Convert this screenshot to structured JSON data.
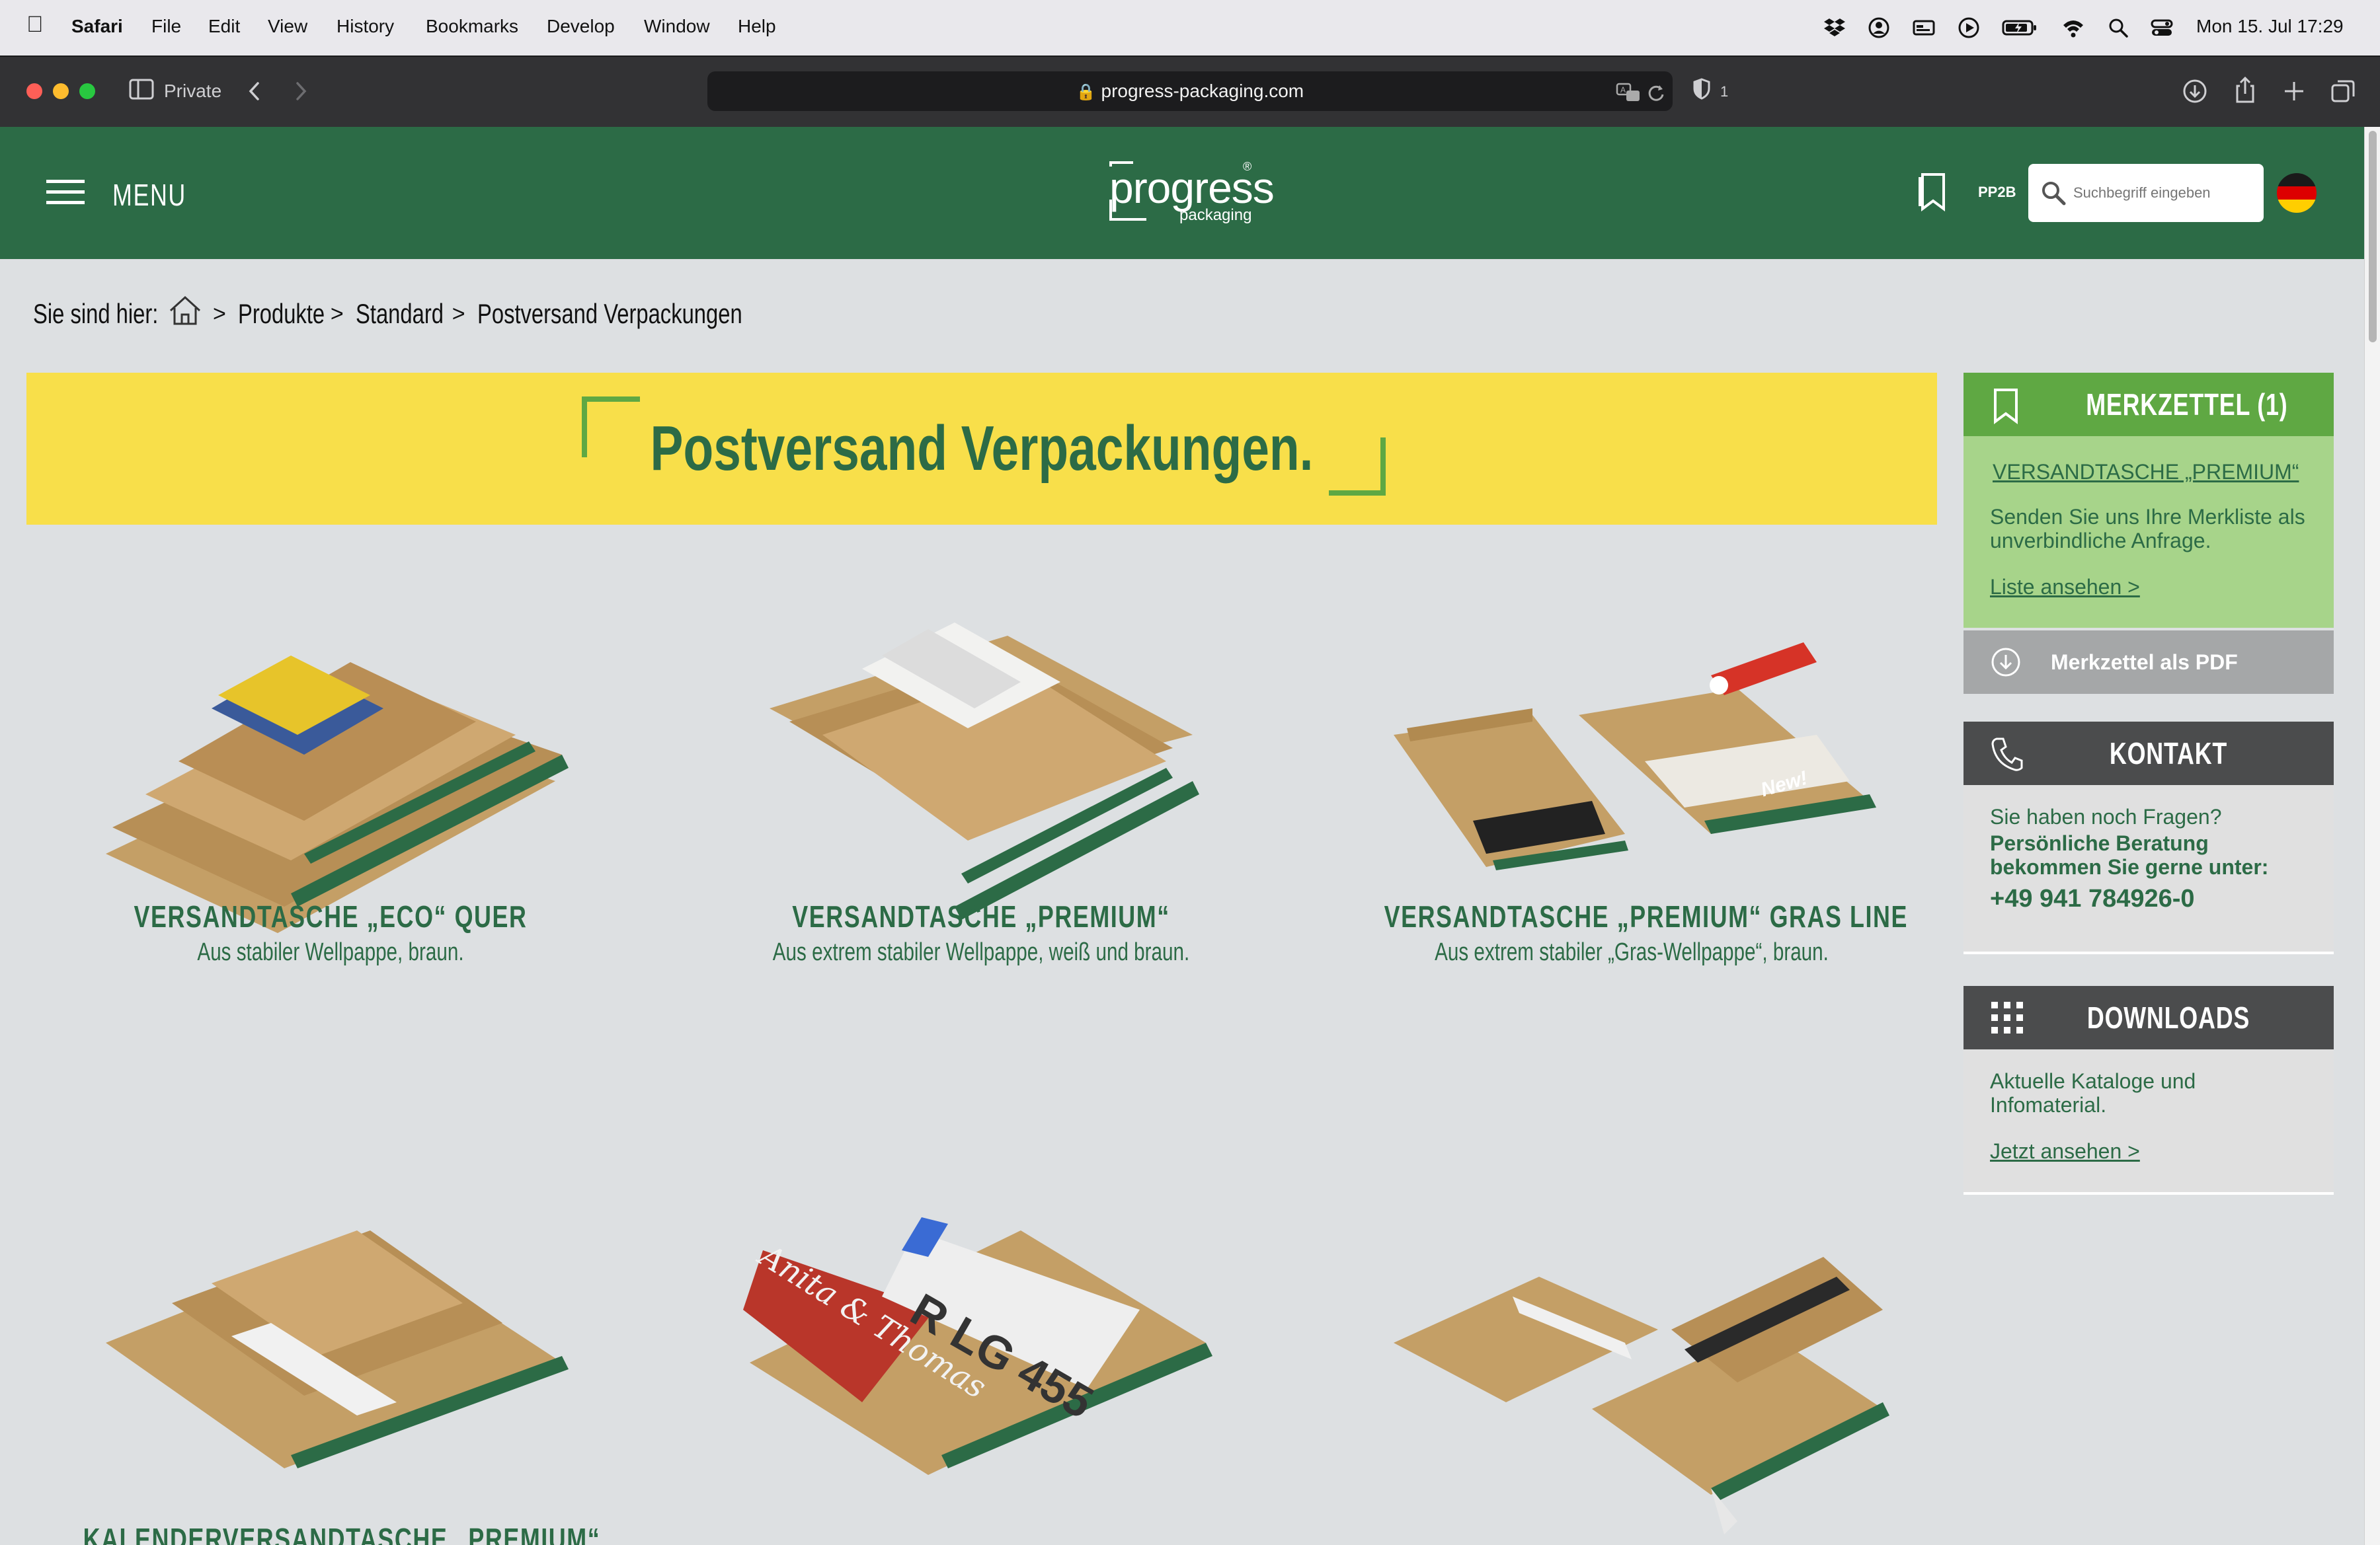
{
  "menubar": {
    "app": "Safari",
    "items": [
      "File",
      "Edit",
      "View",
      "History",
      "Bookmarks",
      "Develop",
      "Window",
      "Help"
    ],
    "clock": "Mon 15. Jul  17:29"
  },
  "toolbar": {
    "private_label": "Private",
    "url": "progress-packaging.com",
    "privacy_count": "1"
  },
  "header": {
    "menu_label": "MENU",
    "logo_main": "progress",
    "logo_sub": "packaging",
    "logo_mark": "®",
    "pp2b_label": "PP2B",
    "search_placeholder": "Suchbegriff eingeben"
  },
  "breadcrumb": {
    "prefix": "Sie sind hier:",
    "items": [
      "Produkte",
      "Standard",
      "Postversand Verpackungen"
    ]
  },
  "banner": {
    "title": "Postversand Verpackungen."
  },
  "products": [
    {
      "title": "VERSANDTASCHE „ECO“ QUER",
      "subtitle": "Aus stabiler Wellpappe, braun."
    },
    {
      "title": "VERSANDTASCHE „PREMIUM“",
      "subtitle": "Aus extrem stabiler Wellpappe, weiß und braun."
    },
    {
      "title": "VERSANDTASCHE „PREMIUM“ GRAS LINE",
      "subtitle": "Aus extrem stabiler „Gras-Wellpappe“, braun.",
      "badge": "New!"
    },
    {
      "title": "KALENDERVERSANDTASCHE „PREMIUM“",
      "subtitle": ""
    },
    {
      "title": "„",
      "subtitle": ""
    },
    {
      "title": "",
      "subtitle": ""
    }
  ],
  "product_images": {
    "plate_text": "R LG 455",
    "sign_text": "Anita & Thomas"
  },
  "sidebar": {
    "merkzettel": {
      "title": "MERKZETTEL (1)",
      "item_link": "VERSANDTASCHE „PREMIUM“",
      "text": "Senden Sie uns Ihre Merkliste als unverbindliche Anfrage.",
      "link": "Liste ansehen >",
      "pdf_label": "Merkzettel als PDF"
    },
    "kontakt": {
      "title": "KONTAKT",
      "question": "Sie haben noch Fragen?",
      "advice": "Persönliche Beratung bekommen Sie gerne unter:",
      "phone": "+49 941 784926-0"
    },
    "downloads": {
      "title": "DOWNLOADS",
      "text": "Aktuelle Kataloge und Infomaterial.",
      "link": "Jetzt ansehen >"
    }
  },
  "colors": {
    "brand_green": "#2c6b46",
    "light_green": "#5fa843",
    "banner_yellow": "#f8df4a",
    "page_bg": "#dde0e2"
  }
}
